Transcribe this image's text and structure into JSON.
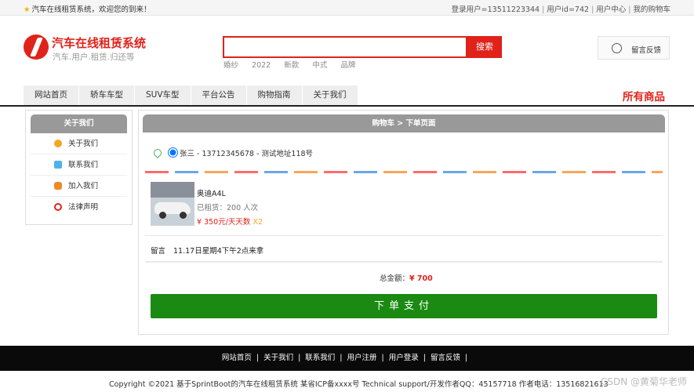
{
  "topbar": {
    "welcome": "汽车在线租赁系统，欢迎您的到来！",
    "login_user": "登录用户=13511223344",
    "user_id": "用户id=742",
    "user_center": "用户中心",
    "my_cart": "我的购物车"
  },
  "brand": {
    "title": "汽车在线租赁系统",
    "subtitle": "汽车.用户.租赁.归还等"
  },
  "search": {
    "placeholder": "",
    "button": "搜索",
    "hot_words": [
      "婚纱",
      "2022",
      "新款",
      "中式",
      "品牌"
    ]
  },
  "feedback": {
    "label": "留言反馈"
  },
  "nav": {
    "items": [
      "网站首页",
      "轿车车型",
      "SUV车型",
      "平台公告",
      "购物指南",
      "关于我们"
    ],
    "all_goods": "所有商品"
  },
  "sidebar": {
    "title": "关于我们",
    "items": [
      {
        "label": "关于我们",
        "color": "#f5a623"
      },
      {
        "label": "联系我们",
        "color": "#4fb3e8"
      },
      {
        "label": "加入我们",
        "color": "#f08a24"
      },
      {
        "label": "法律声明",
        "color": "#e0221a"
      }
    ]
  },
  "order": {
    "breadcrumb": "购物车 > 下单页面",
    "address": "张三 - 13712345678 - 测试地址118号",
    "product": {
      "name": "奥迪A4L",
      "rented": "已租赁：200 人次",
      "price": "¥ 350元/天天数",
      "qty": "X2"
    },
    "remark_label": "留言",
    "remark_value": "11.17日星期4下午2点来拿",
    "total_label": "总金额：",
    "total_amount": "¥ 700",
    "pay_button": "下单支付"
  },
  "footer": {
    "links": [
      "网站首页",
      "关于我们",
      "联系我们",
      "用户注册",
      "用户登录",
      "留言反馈"
    ],
    "copyright": "Copyright ©2021 基于SprintBoot的汽车在线租赁系统    某省ICP备xxxx号    Technical support/开发作者QQ：45157718    作者电话：13516821613",
    "watermark": "CSDN @黄菊华老师"
  },
  "colors": {
    "accent": "#e0221a",
    "pay": "#1a8a12"
  }
}
